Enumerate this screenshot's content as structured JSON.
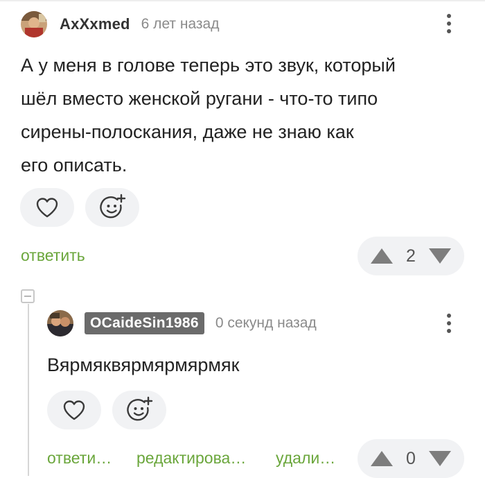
{
  "comments": [
    {
      "username": "AxXxmed",
      "timestamp": "6 лет назад",
      "text": "А у меня в голове теперь это звук, который шёл вместо женской ругани - что-то типо сирены-полоскания, даже не знаю как его описать.",
      "text_lines": [
        "А у меня в голове теперь это звук, который",
        "шёл вместо женской ругани - что-то типо",
        "сирены-полоскания, даже не знаю как",
        "его описать."
      ],
      "actions": [
        "ответить"
      ],
      "rating": "2"
    },
    {
      "username": "OCaideSin1986",
      "timestamp": "0 секунд назад",
      "text": "Вярмяквярмярмярмяк",
      "actions": [
        "ответи…",
        "редактирова…",
        "удали…"
      ],
      "rating": "0"
    }
  ],
  "icons": {
    "like": "heart-icon",
    "reaction": "emoji-add-icon",
    "menu": "kebab-menu-icon",
    "upvote": "arrow-up-icon",
    "downvote": "arrow-down-icon",
    "collapse": "collapse-thread-icon"
  },
  "colors": {
    "link_green": "#6aa63b",
    "button_bg": "#f1f2f4",
    "badge_bg": "#6b6b6b",
    "muted_text": "#8a8a8a",
    "arrow_gray": "#7d7d7d"
  }
}
